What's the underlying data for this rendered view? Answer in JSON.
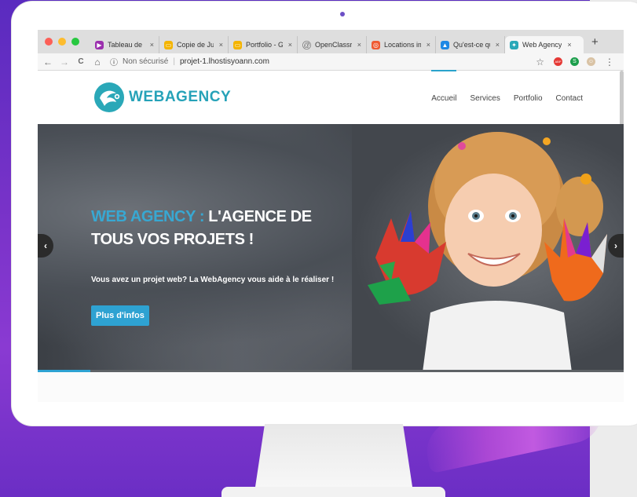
{
  "browser": {
    "tabs": [
      {
        "label": "Tableau de b",
        "fav_color": "#9b2fae",
        "fav_glyph": "▶"
      },
      {
        "label": "Copie de Juli",
        "fav_color": "#f4b400",
        "fav_glyph": "▭"
      },
      {
        "label": "Portfolio - Go",
        "fav_color": "#f4b400",
        "fav_glyph": "▭"
      },
      {
        "label": "OpenClassroo",
        "fav_color": "#ffffff",
        "fav_glyph": "@"
      },
      {
        "label": "Locations imm",
        "fav_color": "#ef5a32",
        "fav_glyph": "◎"
      },
      {
        "label": "Qu'est-ce qu",
        "fav_color": "#1e88e5",
        "fav_glyph": "▲"
      },
      {
        "label": "Web Agency",
        "fav_color": "#2aa8b8",
        "fav_glyph": "✦",
        "active": true
      }
    ],
    "tab_close": "×",
    "new_tab": "+",
    "address": {
      "security_label": "Non sécurisé",
      "separator": "|",
      "url": "projet-1.lhostisyoann.com"
    },
    "icons": {
      "back": "←",
      "forward": "→",
      "reload": "C",
      "home": "⌂",
      "info": "ⓘ",
      "star": "☆",
      "menu": "⋮"
    },
    "extensions": [
      {
        "name": "adblock-icon",
        "color": "#e53935",
        "glyph": "ABP"
      },
      {
        "name": "extension-green-icon",
        "color": "#1b9e4b",
        "glyph": "S"
      },
      {
        "name": "extension-avatar-icon",
        "color": "#d9c3a5",
        "glyph": "☺"
      }
    ]
  },
  "site": {
    "logo_text": "WEBAGENCY",
    "nav": [
      "Accueil",
      "Services",
      "Portfolio",
      "Contact"
    ],
    "hero": {
      "title_accent": "WEB AGENCY :",
      "title_rest": " L'AGENCE DE TOUS VOS PROJETS !",
      "subtitle": "Vous avez un projet web? La WebAgency vous aide à le réaliser !",
      "button": "Plus d'infos",
      "slider_progress": 0.09,
      "prev": "‹",
      "next": "›"
    }
  },
  "colors": {
    "accent": "#2ea2d2",
    "logo": "#26a2b8",
    "traffic_red": "#fc5f57",
    "traffic_yellow": "#fdbc2e",
    "traffic_green": "#27c840"
  }
}
